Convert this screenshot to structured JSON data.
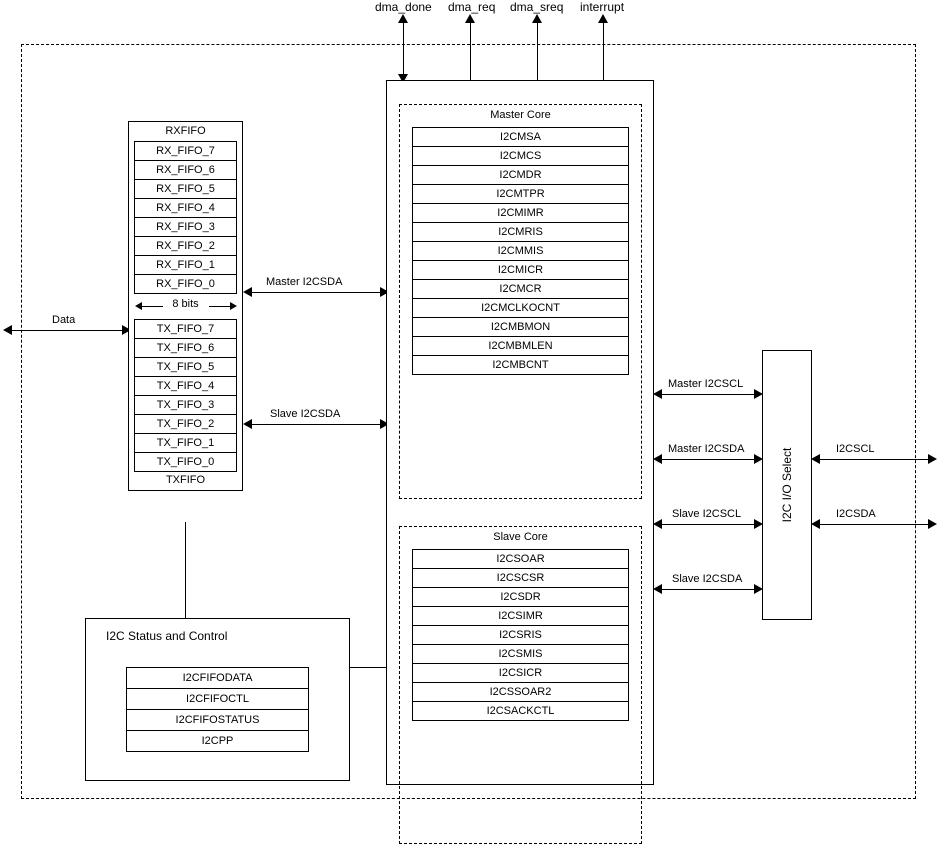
{
  "top_signals": {
    "dma_done": "dma_done",
    "dma_req": "dma_req",
    "dma_sreq": "dma_sreq",
    "interrupt": "interrupt"
  },
  "external": {
    "data": "Data",
    "i2cscl": "I2CSCL",
    "i2csda": "I2CSDA"
  },
  "rxfifo": {
    "title": "RXFIFO",
    "items": [
      "RX_FIFO_7",
      "RX_FIFO_6",
      "RX_FIFO_5",
      "RX_FIFO_4",
      "RX_FIFO_3",
      "RX_FIFO_2",
      "RX_FIFO_1",
      "RX_FIFO_0"
    ]
  },
  "bits_label": "8 bits",
  "txfifo": {
    "title": "TXFIFO",
    "items": [
      "TX_FIFO_7",
      "TX_FIFO_6",
      "TX_FIFO_5",
      "TX_FIFO_4",
      "TX_FIFO_3",
      "TX_FIFO_2",
      "TX_FIFO_1",
      "TX_FIFO_0"
    ]
  },
  "fifo_signals": {
    "master_i2csda": "Master I2CSDA",
    "slave_i2csda": "Slave I2CSDA"
  },
  "status": {
    "title": "I2C Status and Control",
    "items": [
      "I2CFIFODATA",
      "I2CFIFOCTL",
      "I2CFIFOSTATUS",
      "I2CPP"
    ]
  },
  "master_core": {
    "title": "Master Core",
    "items": [
      "I2CMSA",
      "I2CMCS",
      "I2CMDR",
      "I2CMTPR",
      "I2CMIMR",
      "I2CMRIS",
      "I2CMMIS",
      "I2CMICR",
      "I2CMCR",
      "I2CMCLKOCNT",
      "I2CMBMON",
      "I2CMBMLEN",
      "I2CMBCNT"
    ]
  },
  "slave_core": {
    "title": "Slave Core",
    "items": [
      "I2CSOAR",
      "I2CSCSR",
      "I2CSDR",
      "I2CSIMR",
      "I2CSRIS",
      "I2CSMIS",
      "I2CSICR",
      "I2CSSOAR2",
      "I2CSACKCTL"
    ]
  },
  "io_select": {
    "title": "I2C I/O  Select",
    "signals": {
      "master_i2cscl": "Master I2CSCL",
      "master_i2csda": "Master I2CSDA",
      "slave_i2cscl": "Slave I2CSCL",
      "slave_i2csda": "Slave I2CSDA"
    }
  }
}
